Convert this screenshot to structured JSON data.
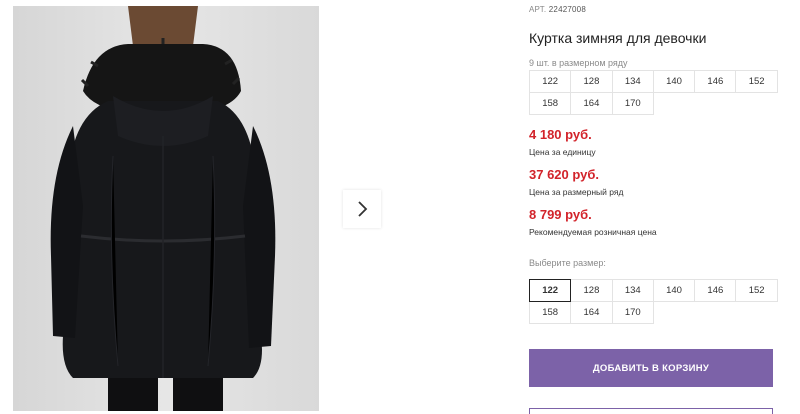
{
  "gallery": {
    "image_alt_icon": "jacket-photo",
    "next_icon": "chevron-right-icon"
  },
  "product": {
    "article_label": "АРТ.",
    "article_number": "22427008",
    "title": "Куртка зимняя для девочки",
    "pack_label": "9 шт. в размерном ряду",
    "pack_sizes": [
      "122",
      "128",
      "134",
      "140",
      "146",
      "152",
      "158",
      "164",
      "170"
    ],
    "price_unit": "4 180 руб.",
    "price_unit_label": "Цена за единицу",
    "price_pack": "37 620 руб.",
    "price_pack_label": "Цена за размерный ряд",
    "price_retail": "8 799 руб.",
    "price_retail_label": "Рекомендуемая розничная цена",
    "choose_size_label": "Выберите размер:",
    "sizes": [
      "122",
      "128",
      "134",
      "140",
      "146",
      "152",
      "158",
      "164",
      "170"
    ],
    "selected_size": "122",
    "add_to_cart": "ДОБАВИТЬ В КОРЗИНУ"
  },
  "colors": {
    "price": "#d2232a",
    "accent": "#7c62a8"
  }
}
